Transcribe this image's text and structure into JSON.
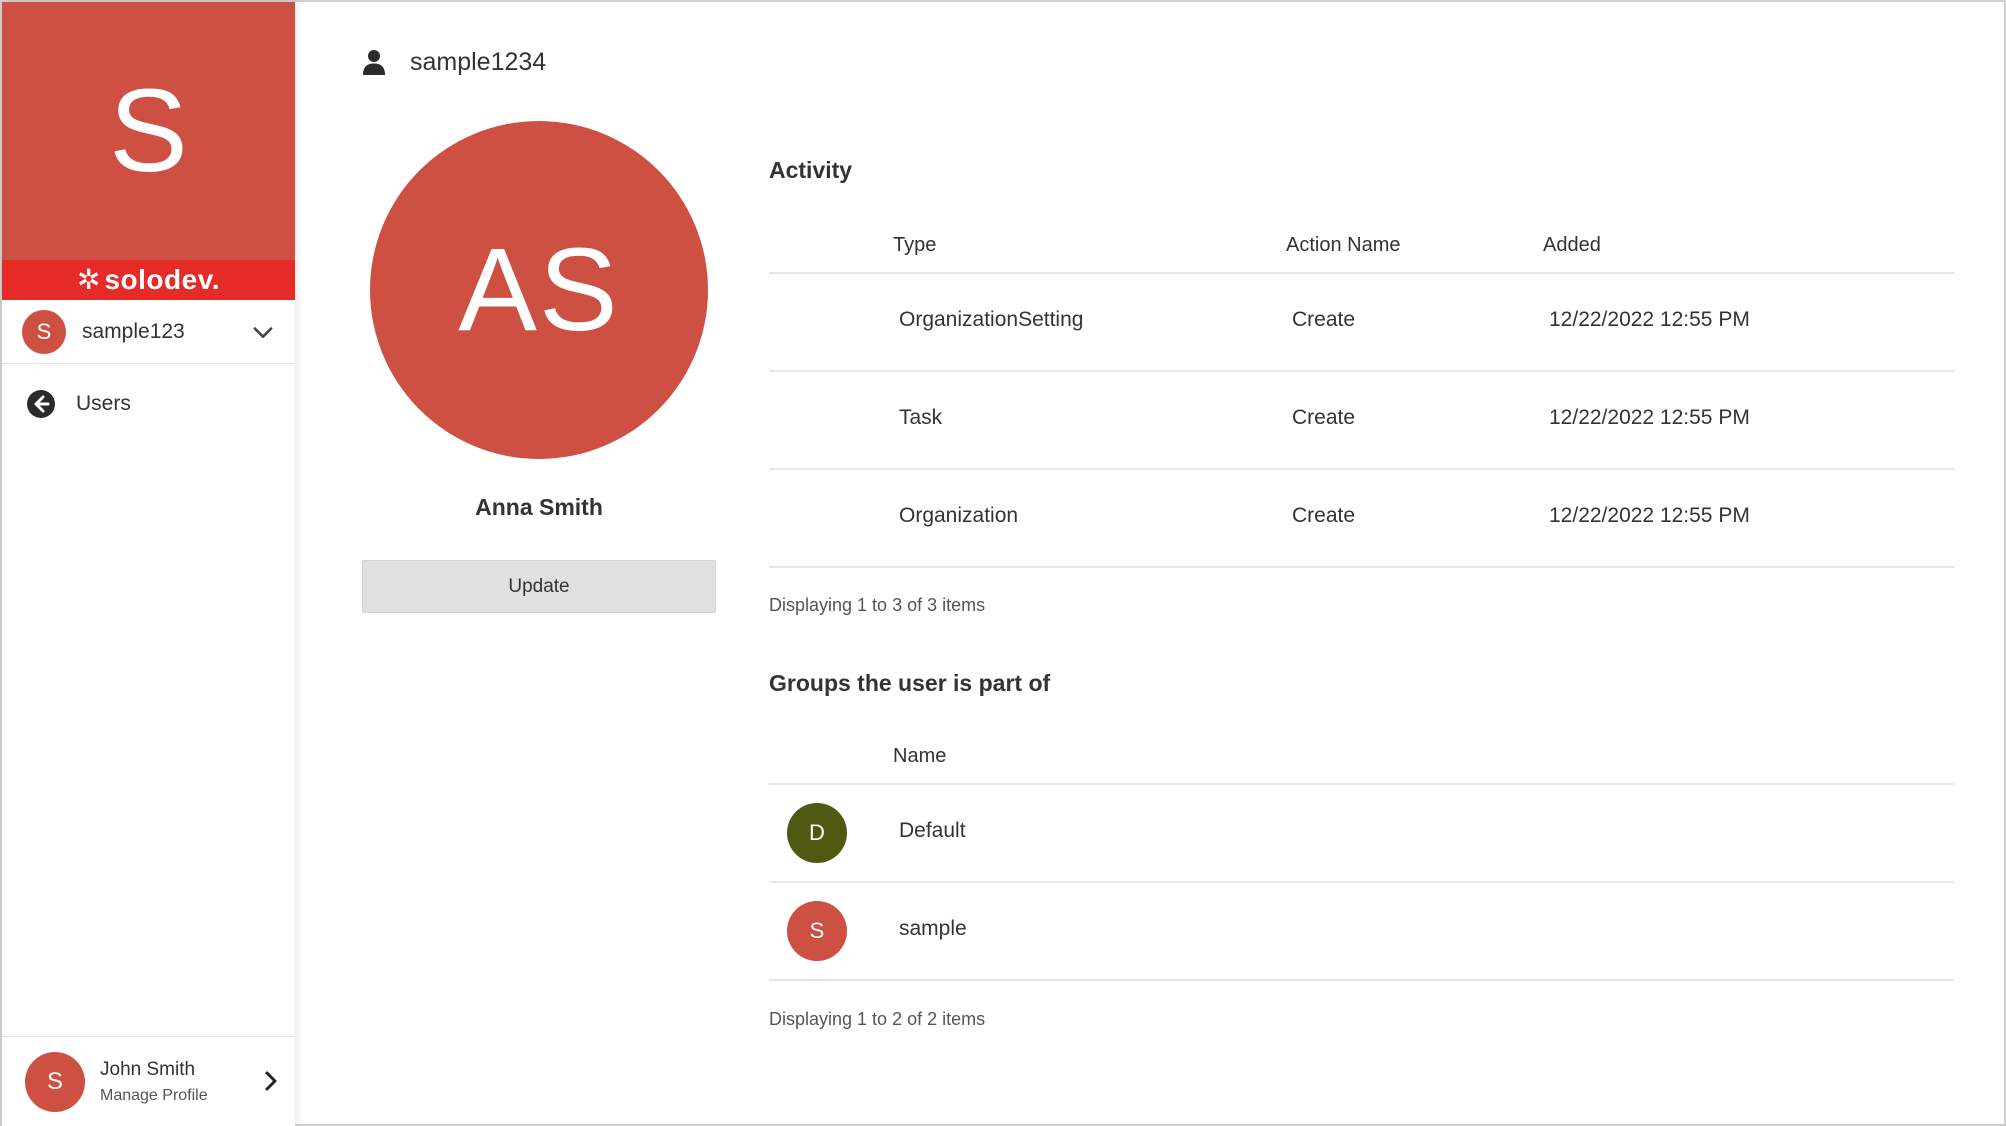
{
  "colors": {
    "brand": "#cd5042",
    "brand_strip": "#e62a28",
    "group_default": "#4f5a10",
    "group_sample": "#cd5042",
    "button_bg": "#e0e0e0"
  },
  "sidebar": {
    "brand_letter": "S",
    "logo_text": "solodev.",
    "org": {
      "avatar_letter": "S",
      "name": "sample123"
    },
    "nav": [
      {
        "label": "Users",
        "icon": "back-arrow-circle-icon"
      }
    ],
    "profile": {
      "avatar_letter": "S",
      "name": "John Smith",
      "subtitle": "Manage Profile"
    }
  },
  "header": {
    "icon": "user-icon",
    "title": "sample1234"
  },
  "user": {
    "initials": "AS",
    "full_name": "Anna Smith",
    "update_label": "Update"
  },
  "activity": {
    "title": "Activity",
    "columns": [
      "Type",
      "Action Name",
      "Added"
    ],
    "rows": [
      {
        "type": "OrganizationSetting",
        "action": "Create",
        "added": "12/22/2022 12:55 PM"
      },
      {
        "type": "Task",
        "action": "Create",
        "added": "12/22/2022 12:55 PM"
      },
      {
        "type": "Organization",
        "action": "Create",
        "added": "12/22/2022 12:55 PM"
      }
    ],
    "footer": "Displaying 1 to 3 of 3 items"
  },
  "groups": {
    "title": "Groups the user is part of",
    "columns": [
      "Name"
    ],
    "rows": [
      {
        "letter": "D",
        "name": "Default"
      },
      {
        "letter": "S",
        "name": "sample"
      }
    ],
    "footer": "Displaying 1 to 2 of 2 items"
  }
}
